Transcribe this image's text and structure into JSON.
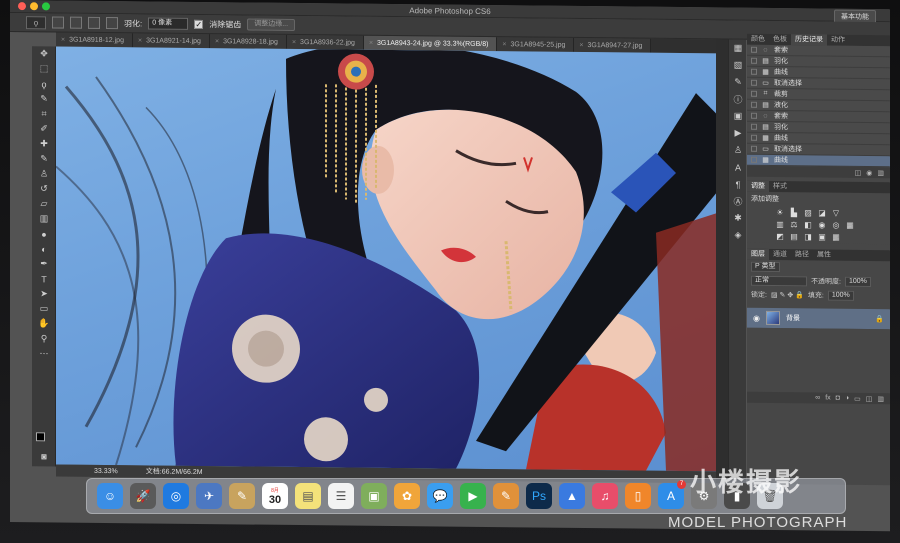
{
  "window": {
    "app_title": "Adobe Photoshop CS6",
    "workspace_button": "基本功能"
  },
  "options": {
    "feather_label": "羽化:",
    "feather_value": "0 像素",
    "antialias_checked": "✓",
    "antialias_label": "消除锯齿",
    "refine_edge_button": "调整边缘..."
  },
  "tabs": [
    {
      "label": "3G1A8918-12.jpg",
      "active": false
    },
    {
      "label": "3G1A8921-14.jpg",
      "active": false
    },
    {
      "label": "3G1A8928-18.jpg",
      "active": false
    },
    {
      "label": "3G1A8936-22.jpg",
      "active": false
    },
    {
      "label": "3G1A8943-24.jpg @ 33.3%(RGB/8)",
      "active": true
    },
    {
      "label": "3G1A8945-25.jpg",
      "active": false
    },
    {
      "label": "3G1A8947-27.jpg",
      "active": false
    }
  ],
  "status": {
    "zoom": "33.33%",
    "doc_size": "文档:66.2M/66.2M"
  },
  "panels": {
    "top_tabs": [
      "颜色",
      "色板",
      "历史记录",
      "动作"
    ],
    "history": [
      {
        "icon": "lasso-icon",
        "glyph": "◌",
        "label": "套索"
      },
      {
        "icon": "feather-icon",
        "glyph": "▤",
        "label": "羽化"
      },
      {
        "icon": "curves-icon",
        "glyph": "▦",
        "label": "曲线"
      },
      {
        "icon": "deselect-icon",
        "glyph": "▭",
        "label": "取消选择"
      },
      {
        "icon": "crop-icon",
        "glyph": "⌗",
        "label": "裁剪"
      },
      {
        "icon": "liquify-icon",
        "glyph": "▤",
        "label": "液化"
      },
      {
        "icon": "lasso-icon",
        "glyph": "◌",
        "label": "套索"
      },
      {
        "icon": "feather-icon",
        "glyph": "▤",
        "label": "羽化"
      },
      {
        "icon": "curves-icon",
        "glyph": "▦",
        "label": "曲线"
      },
      {
        "icon": "deselect-icon",
        "glyph": "▭",
        "label": "取消选择"
      },
      {
        "icon": "curves-icon",
        "glyph": "▦",
        "label": "曲线"
      }
    ],
    "adjust_tabs": [
      "调整",
      "样式"
    ],
    "adjust_title": "添加调整",
    "layers_tabs": [
      "图层",
      "通道",
      "路径",
      "属性"
    ],
    "layer_kind": "P 类型",
    "blend_mode": "正常",
    "opacity_label": "不透明度:",
    "opacity_value": "100%",
    "lock_label": "锁定:",
    "fill_label": "填充:",
    "fill_value": "100%",
    "layer_name": "背景"
  },
  "dock": [
    {
      "name": "finder-icon",
      "glyph": "☺",
      "color": "#3a8ee6"
    },
    {
      "name": "launchpad-icon",
      "glyph": "🚀",
      "color": "#5a5a5a"
    },
    {
      "name": "safari-icon",
      "glyph": "◎",
      "color": "#1f7ae0"
    },
    {
      "name": "preview-icon",
      "glyph": "✈",
      "color": "#4c78c2"
    },
    {
      "name": "notes-icon",
      "glyph": "✎",
      "color": "#c8a35e"
    },
    {
      "name": "calendar-icon",
      "glyph": "30",
      "color": "#ffffff"
    },
    {
      "name": "stickies-icon",
      "glyph": "▤",
      "color": "#f4e27a"
    },
    {
      "name": "reminders-icon",
      "glyph": "☰",
      "color": "#f3f3f3"
    },
    {
      "name": "photo-booth-icon",
      "glyph": "▣",
      "color": "#7fae5c"
    },
    {
      "name": "photos-icon",
      "glyph": "✿",
      "color": "#f0a53a"
    },
    {
      "name": "messages-icon",
      "glyph": "💬",
      "color": "#3a9ef0"
    },
    {
      "name": "facetime-icon",
      "glyph": "▶",
      "color": "#37b24d"
    },
    {
      "name": "pages-icon",
      "glyph": "✎",
      "color": "#e0913a"
    },
    {
      "name": "photoshop-icon",
      "glyph": "Ps",
      "color": "#0d2a4a"
    },
    {
      "name": "keynote-icon",
      "glyph": "▲",
      "color": "#3a7ae0"
    },
    {
      "name": "itunes-icon",
      "glyph": "♫",
      "color": "#e84d6a"
    },
    {
      "name": "ibooks-icon",
      "glyph": "▯",
      "color": "#f0862a"
    },
    {
      "name": "app-store-icon",
      "glyph": "A",
      "color": "#2e8de8",
      "badge": "7"
    },
    {
      "name": "system-preferences-icon",
      "glyph": "⚙",
      "color": "#7a7a7a"
    },
    {
      "name": "activity-icon",
      "glyph": "▮",
      "color": "#4a4a4a"
    },
    {
      "name": "trash-icon",
      "glyph": "🗑",
      "color": "#cfd3d8"
    }
  ],
  "calendar": {
    "month": "8月",
    "day": "30"
  },
  "watermark": {
    "logo": "小楼摄影",
    "text": "MODEL PHOTOGRAPH"
  }
}
